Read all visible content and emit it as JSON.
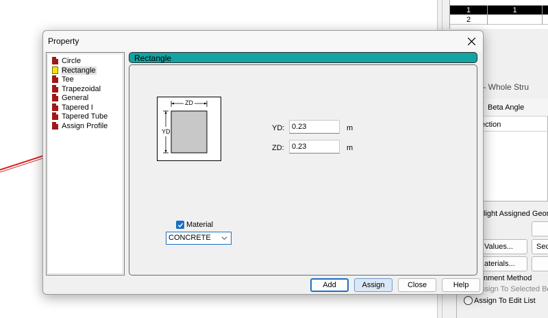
{
  "background": {
    "grid": {
      "rows": [
        {
          "cells": [
            "1",
            "1"
          ],
          "selected": true
        },
        {
          "cells": [
            "2",
            ""
          ],
          "selected": false
        }
      ]
    },
    "properties_panel": {
      "title": "perties - Whole Stru",
      "column_header": "Beta Angle",
      "column_sub": "ection",
      "highlight_text": "light Assigned Geom",
      "values_button": "Values...",
      "sec_button": "Sec",
      "materials_button": "aterials...",
      "method_label": "nment Method",
      "assign_selected": "ssign To Selected Bea",
      "assign_edit_list": "Assign To Edit List"
    }
  },
  "dialog": {
    "title": "Property",
    "close_icon": "close-icon",
    "tree": {
      "items": [
        {
          "label": "Circle",
          "icon": "profile-doc-icon",
          "selected": false
        },
        {
          "label": "Rectangle",
          "icon": "profile-selected-icon",
          "selected": true
        },
        {
          "label": "Tee",
          "icon": "profile-doc-icon",
          "selected": false
        },
        {
          "label": "Trapezoidal",
          "icon": "profile-doc-icon",
          "selected": false
        },
        {
          "label": "General",
          "icon": "profile-doc-icon",
          "selected": false
        },
        {
          "label": "Tapered I",
          "icon": "profile-doc-icon",
          "selected": false
        },
        {
          "label": "Tapered Tube",
          "icon": "profile-doc-icon",
          "selected": false
        },
        {
          "label": "Assign Profile",
          "icon": "profile-doc-icon",
          "selected": false
        }
      ]
    },
    "section_header": "Rectangle",
    "diagram": {
      "zd_label": "ZD",
      "yd_label": "YD"
    },
    "fields": {
      "yd": {
        "label": "YD:",
        "value": "0.23",
        "unit": "m"
      },
      "zd": {
        "label": "ZD:",
        "value": "0.23",
        "unit": "m"
      }
    },
    "material": {
      "checkbox_label": "Material",
      "checked": true,
      "selected": "CONCRETE"
    },
    "buttons": {
      "add": "Add",
      "assign": "Assign",
      "close": "Close",
      "help": "Help"
    },
    "colors": {
      "header_bar": "#14a3a3",
      "accent": "#1a6fc4",
      "profile_icon": "#a01818",
      "selected_icon": "#f4e400"
    }
  }
}
